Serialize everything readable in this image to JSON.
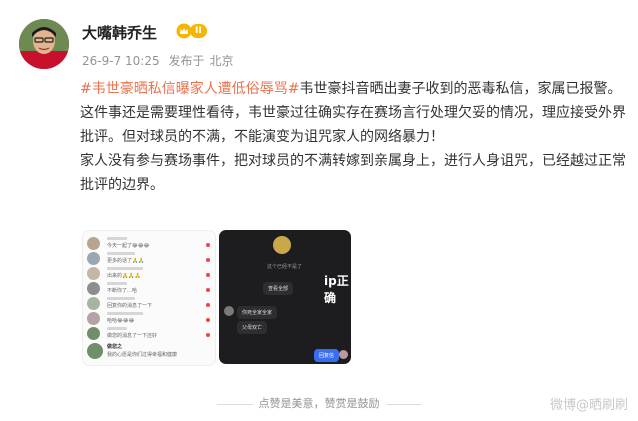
{
  "author": {
    "name": "大嘴韩乔生",
    "level": "II"
  },
  "meta": {
    "date": "26-9-7 10:25",
    "source_prefix": "发布于",
    "location": "北京"
  },
  "post": {
    "tag1": "#韦世豪晒私信曝家人遭低俗辱骂#",
    "line1_rest": "韦世豪抖音晒出妻子收到的恶毒私信，家属已报警。",
    "para2": "这件事还是需要理性看待，韦世豪过往确实存在赛场言行处理欠妥的情况，理应接受外界批评。但对球员的不满，不能演变为诅咒家人的网络暴力！",
    "para3": "家人没有参与赛场事件，把对球员的不满转嫁到亲属身上，进行人身诅咒，已经越过正常批评的边界。"
  },
  "image1": {
    "rows": [
      {
        "text": "今天一起了😂😂😂",
        "avatar_color": "#b8a58f"
      },
      {
        "text": "更多的话了🙏🙏",
        "avatar_color": "#9aa7b2"
      },
      {
        "text": "出来的🙏🙏🙏",
        "avatar_color": "#c4b7a6"
      },
      {
        "text": "不断你了…哈",
        "avatar_color": "#8e8e8e"
      },
      {
        "text": "回复你的消息了一下",
        "avatar_color": "#a7b5a0"
      },
      {
        "text": "哈哈😂😂😂",
        "avatar_color": "#b3a3a3"
      },
      {
        "text": "做您的消息了一下还好",
        "avatar_color": "#6f8f6a"
      }
    ],
    "last_name": "做您之",
    "last_sub": "我的心愿是你们过得幸福和健康"
  },
  "image2": {
    "ip_label": "ip正确",
    "top_caption": "这个已经不是了",
    "mid_caption": "查看全部",
    "bubble1": "你死全家全家",
    "bubble2": "父母双亡",
    "reply": "回复信"
  },
  "footer": {
    "text": "点赞是美意，赞赏是鼓励"
  },
  "watermark": "微博@晒刷刷"
}
